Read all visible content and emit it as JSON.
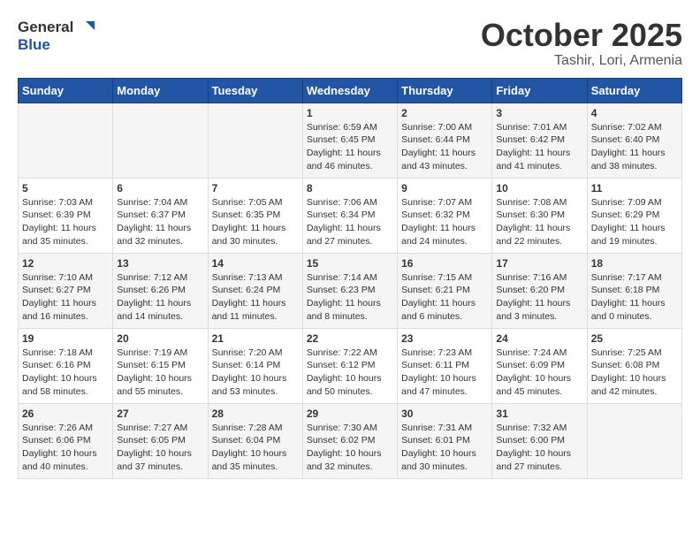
{
  "header": {
    "logo_general": "General",
    "logo_blue": "Blue",
    "month": "October 2025",
    "location": "Tashir, Lori, Armenia"
  },
  "weekdays": [
    "Sunday",
    "Monday",
    "Tuesday",
    "Wednesday",
    "Thursday",
    "Friday",
    "Saturday"
  ],
  "weeks": [
    [
      {
        "day": "",
        "sunrise": "",
        "sunset": "",
        "daylight": ""
      },
      {
        "day": "",
        "sunrise": "",
        "sunset": "",
        "daylight": ""
      },
      {
        "day": "",
        "sunrise": "",
        "sunset": "",
        "daylight": ""
      },
      {
        "day": "1",
        "sunrise": "Sunrise: 6:59 AM",
        "sunset": "Sunset: 6:45 PM",
        "daylight": "Daylight: 11 hours and 46 minutes."
      },
      {
        "day": "2",
        "sunrise": "Sunrise: 7:00 AM",
        "sunset": "Sunset: 6:44 PM",
        "daylight": "Daylight: 11 hours and 43 minutes."
      },
      {
        "day": "3",
        "sunrise": "Sunrise: 7:01 AM",
        "sunset": "Sunset: 6:42 PM",
        "daylight": "Daylight: 11 hours and 41 minutes."
      },
      {
        "day": "4",
        "sunrise": "Sunrise: 7:02 AM",
        "sunset": "Sunset: 6:40 PM",
        "daylight": "Daylight: 11 hours and 38 minutes."
      }
    ],
    [
      {
        "day": "5",
        "sunrise": "Sunrise: 7:03 AM",
        "sunset": "Sunset: 6:39 PM",
        "daylight": "Daylight: 11 hours and 35 minutes."
      },
      {
        "day": "6",
        "sunrise": "Sunrise: 7:04 AM",
        "sunset": "Sunset: 6:37 PM",
        "daylight": "Daylight: 11 hours and 32 minutes."
      },
      {
        "day": "7",
        "sunrise": "Sunrise: 7:05 AM",
        "sunset": "Sunset: 6:35 PM",
        "daylight": "Daylight: 11 hours and 30 minutes."
      },
      {
        "day": "8",
        "sunrise": "Sunrise: 7:06 AM",
        "sunset": "Sunset: 6:34 PM",
        "daylight": "Daylight: 11 hours and 27 minutes."
      },
      {
        "day": "9",
        "sunrise": "Sunrise: 7:07 AM",
        "sunset": "Sunset: 6:32 PM",
        "daylight": "Daylight: 11 hours and 24 minutes."
      },
      {
        "day": "10",
        "sunrise": "Sunrise: 7:08 AM",
        "sunset": "Sunset: 6:30 PM",
        "daylight": "Daylight: 11 hours and 22 minutes."
      },
      {
        "day": "11",
        "sunrise": "Sunrise: 7:09 AM",
        "sunset": "Sunset: 6:29 PM",
        "daylight": "Daylight: 11 hours and 19 minutes."
      }
    ],
    [
      {
        "day": "12",
        "sunrise": "Sunrise: 7:10 AM",
        "sunset": "Sunset: 6:27 PM",
        "daylight": "Daylight: 11 hours and 16 minutes."
      },
      {
        "day": "13",
        "sunrise": "Sunrise: 7:12 AM",
        "sunset": "Sunset: 6:26 PM",
        "daylight": "Daylight: 11 hours and 14 minutes."
      },
      {
        "day": "14",
        "sunrise": "Sunrise: 7:13 AM",
        "sunset": "Sunset: 6:24 PM",
        "daylight": "Daylight: 11 hours and 11 minutes."
      },
      {
        "day": "15",
        "sunrise": "Sunrise: 7:14 AM",
        "sunset": "Sunset: 6:23 PM",
        "daylight": "Daylight: 11 hours and 8 minutes."
      },
      {
        "day": "16",
        "sunrise": "Sunrise: 7:15 AM",
        "sunset": "Sunset: 6:21 PM",
        "daylight": "Daylight: 11 hours and 6 minutes."
      },
      {
        "day": "17",
        "sunrise": "Sunrise: 7:16 AM",
        "sunset": "Sunset: 6:20 PM",
        "daylight": "Daylight: 11 hours and 3 minutes."
      },
      {
        "day": "18",
        "sunrise": "Sunrise: 7:17 AM",
        "sunset": "Sunset: 6:18 PM",
        "daylight": "Daylight: 11 hours and 0 minutes."
      }
    ],
    [
      {
        "day": "19",
        "sunrise": "Sunrise: 7:18 AM",
        "sunset": "Sunset: 6:16 PM",
        "daylight": "Daylight: 10 hours and 58 minutes."
      },
      {
        "day": "20",
        "sunrise": "Sunrise: 7:19 AM",
        "sunset": "Sunset: 6:15 PM",
        "daylight": "Daylight: 10 hours and 55 minutes."
      },
      {
        "day": "21",
        "sunrise": "Sunrise: 7:20 AM",
        "sunset": "Sunset: 6:14 PM",
        "daylight": "Daylight: 10 hours and 53 minutes."
      },
      {
        "day": "22",
        "sunrise": "Sunrise: 7:22 AM",
        "sunset": "Sunset: 6:12 PM",
        "daylight": "Daylight: 10 hours and 50 minutes."
      },
      {
        "day": "23",
        "sunrise": "Sunrise: 7:23 AM",
        "sunset": "Sunset: 6:11 PM",
        "daylight": "Daylight: 10 hours and 47 minutes."
      },
      {
        "day": "24",
        "sunrise": "Sunrise: 7:24 AM",
        "sunset": "Sunset: 6:09 PM",
        "daylight": "Daylight: 10 hours and 45 minutes."
      },
      {
        "day": "25",
        "sunrise": "Sunrise: 7:25 AM",
        "sunset": "Sunset: 6:08 PM",
        "daylight": "Daylight: 10 hours and 42 minutes."
      }
    ],
    [
      {
        "day": "26",
        "sunrise": "Sunrise: 7:26 AM",
        "sunset": "Sunset: 6:06 PM",
        "daylight": "Daylight: 10 hours and 40 minutes."
      },
      {
        "day": "27",
        "sunrise": "Sunrise: 7:27 AM",
        "sunset": "Sunset: 6:05 PM",
        "daylight": "Daylight: 10 hours and 37 minutes."
      },
      {
        "day": "28",
        "sunrise": "Sunrise: 7:28 AM",
        "sunset": "Sunset: 6:04 PM",
        "daylight": "Daylight: 10 hours and 35 minutes."
      },
      {
        "day": "29",
        "sunrise": "Sunrise: 7:30 AM",
        "sunset": "Sunset: 6:02 PM",
        "daylight": "Daylight: 10 hours and 32 minutes."
      },
      {
        "day": "30",
        "sunrise": "Sunrise: 7:31 AM",
        "sunset": "Sunset: 6:01 PM",
        "daylight": "Daylight: 10 hours and 30 minutes."
      },
      {
        "day": "31",
        "sunrise": "Sunrise: 7:32 AM",
        "sunset": "Sunset: 6:00 PM",
        "daylight": "Daylight: 10 hours and 27 minutes."
      },
      {
        "day": "",
        "sunrise": "",
        "sunset": "",
        "daylight": ""
      }
    ]
  ]
}
